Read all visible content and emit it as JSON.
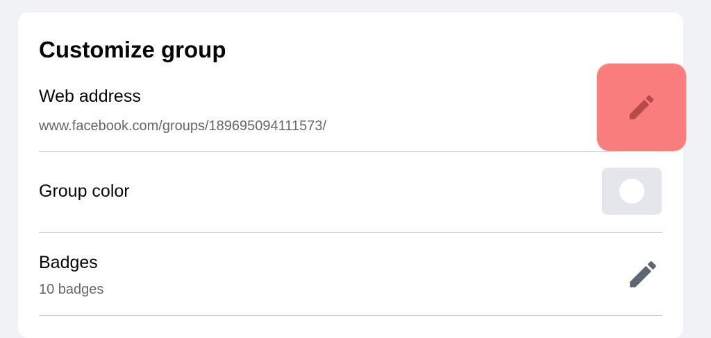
{
  "panel": {
    "title": "Customize group"
  },
  "web_address": {
    "label": "Web address",
    "value": "www.facebook.com/groups/189695094111573/",
    "edit_icon": "pencil-icon",
    "highlight_color": "#fa7d7d"
  },
  "group_color": {
    "label": "Group color",
    "swatch_color": "#ffffff"
  },
  "badges": {
    "label": "Badges",
    "count": "10 badges",
    "edit_icon": "pencil-icon"
  },
  "colors": {
    "page_background": "#f0f2f5",
    "card_background": "#ffffff",
    "primary_text": "#050505",
    "secondary_text": "#65676b",
    "icon": "#606770"
  }
}
